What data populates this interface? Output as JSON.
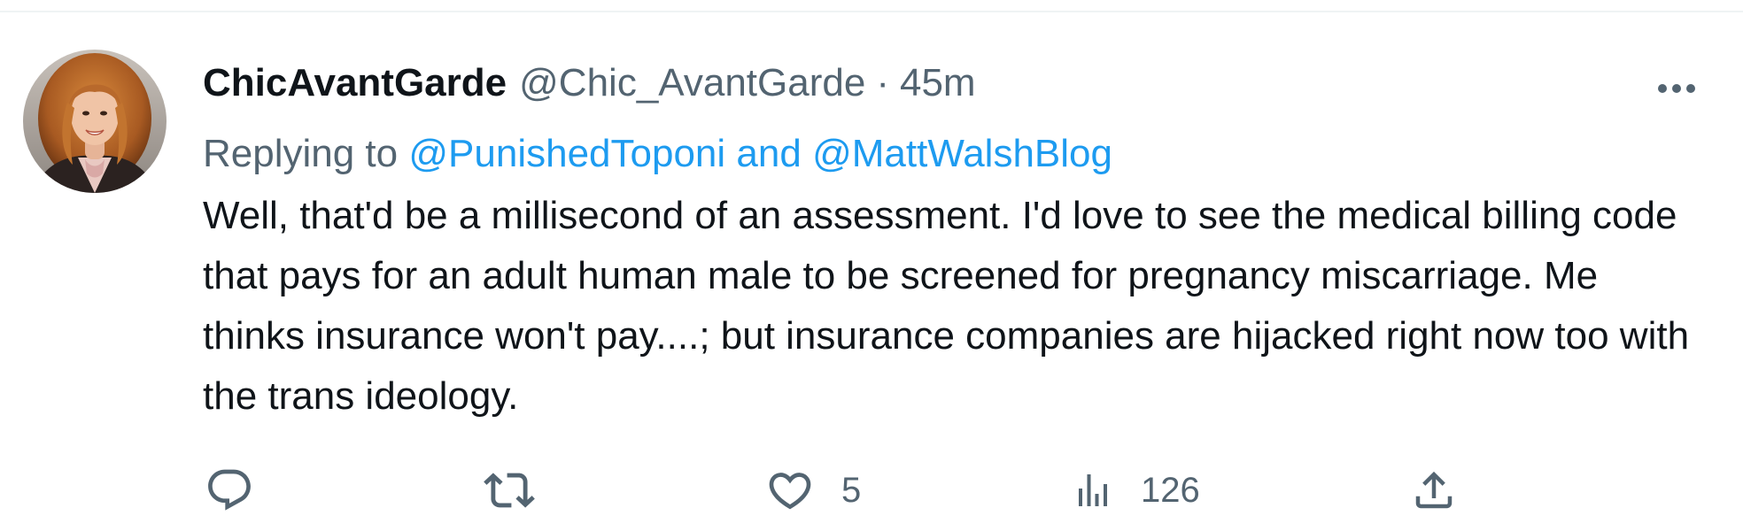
{
  "tweet": {
    "author": {
      "display_name": "ChicAvantGarde",
      "handle": "@Chic_AvantGarde"
    },
    "separator": "·",
    "timestamp": "45m",
    "replying_prefix": "Replying to",
    "replying_to": [
      "@PunishedToponi",
      "@MattWalshBlog"
    ],
    "replying_joiner": "and",
    "text": "Well, that'd be a millisecond of an assessment. I'd love to see the medical billing code that pays for an adult human male to be screened for pregnancy miscarriage. Me thinks insurance won't pay....; but insurance companies are hijacked right now too with the trans ideology.",
    "actions": {
      "reply": {
        "icon": "reply-icon",
        "count": ""
      },
      "retweet": {
        "icon": "retweet-icon",
        "count": ""
      },
      "like": {
        "icon": "heart-icon",
        "count": "5"
      },
      "views": {
        "icon": "views-icon",
        "count": "126"
      },
      "share": {
        "icon": "share-icon"
      }
    },
    "more_icon": "ellipsis-icon"
  },
  "colors": {
    "text_primary": "#0f1419",
    "text_secondary": "#536471",
    "link": "#1d9bf0",
    "divider": "#eff3f4"
  }
}
